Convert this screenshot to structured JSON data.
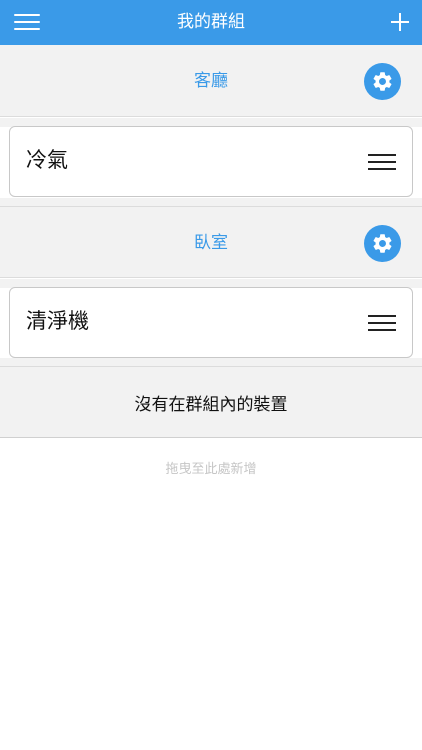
{
  "header": {
    "title": "我的群組",
    "menu_icon": "hamburger-menu-icon",
    "add_icon": "plus-icon",
    "background": "#3a9ae8"
  },
  "groups": [
    {
      "name": "客廳",
      "settings_icon": "gear-icon",
      "devices": [
        {
          "name": "冷氣",
          "handle_icon": "drag-handle-icon"
        }
      ]
    },
    {
      "name": "臥室",
      "settings_icon": "gear-icon",
      "devices": [
        {
          "name": "清淨機",
          "handle_icon": "drag-handle-icon"
        }
      ]
    }
  ],
  "ungrouped": {
    "title": "沒有在群組內的裝置",
    "drop_hint": "拖曳至此處新增"
  },
  "colors": {
    "accent": "#3a9ae8",
    "section_bg": "#f2f2f2"
  }
}
